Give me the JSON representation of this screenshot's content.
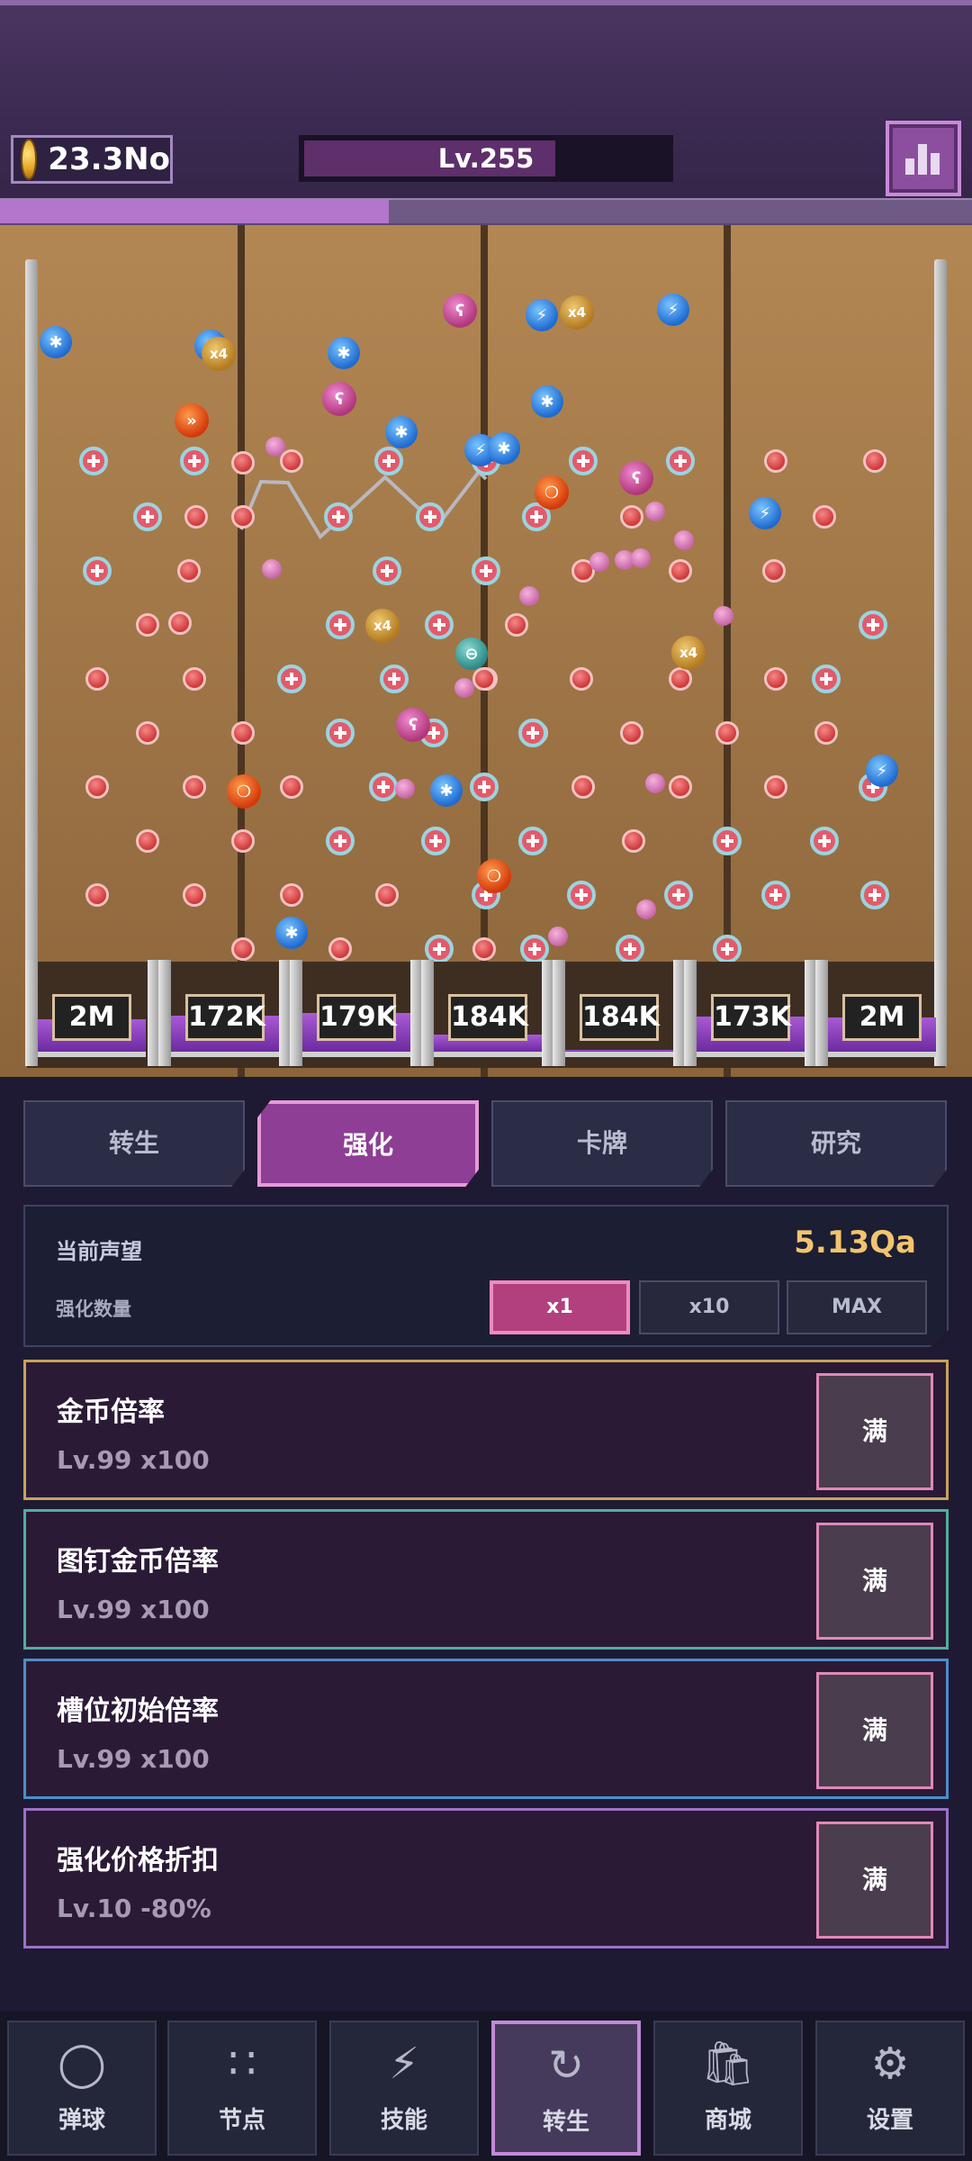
{
  "header": {
    "coins": "23.3No",
    "level": "Lv.255",
    "level_progress": 0.68,
    "stage_progress": 0.4
  },
  "board": {
    "ball_multiplier": "x4",
    "slots": [
      "2M",
      "172K",
      "179K",
      "184K",
      "184K",
      "173K",
      "2M"
    ]
  },
  "tabs": [
    {
      "label": "转生"
    },
    {
      "label": "强化"
    },
    {
      "label": "卡牌"
    },
    {
      "label": "研究"
    }
  ],
  "reputation": {
    "label": "当前声望",
    "value": "5.13Qa",
    "qty_label": "强化数量",
    "qty_options": [
      "x1",
      "x10",
      "MAX"
    ],
    "qty_selected": "x1"
  },
  "upgrades": [
    {
      "title": "金币倍率",
      "level": "Lv.99",
      "effect": "x100",
      "button": "满",
      "border": "#c9a25a"
    },
    {
      "title": "图钉金币倍率",
      "level": "Lv.99",
      "effect": "x100",
      "button": "满",
      "border": "#4fae9e"
    },
    {
      "title": "槽位初始倍率",
      "level": "Lv.99",
      "effect": "x100",
      "button": "满",
      "border": "#4b8ec8"
    },
    {
      "title": "强化价格折扣",
      "level": "Lv.10",
      "effect": "-80%",
      "button": "满",
      "border": "#9a72c8"
    }
  ],
  "nav": [
    {
      "label": "弹球",
      "icon": "pinball-icon"
    },
    {
      "label": "节点",
      "icon": "nodes-icon"
    },
    {
      "label": "技能",
      "icon": "lightning-icon"
    },
    {
      "label": "转生",
      "icon": "rebirth-icon"
    },
    {
      "label": "商城",
      "icon": "shop-bag-icon"
    },
    {
      "label": "设置",
      "icon": "gear-icon"
    }
  ]
}
